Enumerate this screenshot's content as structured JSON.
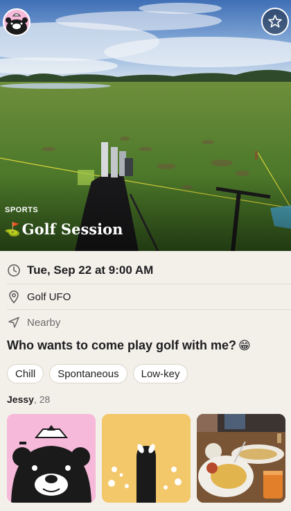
{
  "hero": {
    "category": "SPORTS",
    "title_emoji": "⛳",
    "title": "Golf Session"
  },
  "event": {
    "datetime": "Tue, Sep 22 at 9:00 AM",
    "location": "Golf UFO",
    "distance": "Nearby"
  },
  "description": {
    "text": "Who wants to come play golf with me?",
    "emoji": "😁"
  },
  "tags": [
    "Chill",
    "Spontaneous",
    "Low-key"
  ],
  "host": {
    "name": "Jessy",
    "age": ", 28"
  },
  "colors": {
    "background": "#f3f0ea",
    "avatar_pink": "#f6b9d9",
    "photo_yellow": "#f3c86a",
    "text_primary": "#1d1d1f",
    "text_secondary": "#6b6b6b"
  }
}
